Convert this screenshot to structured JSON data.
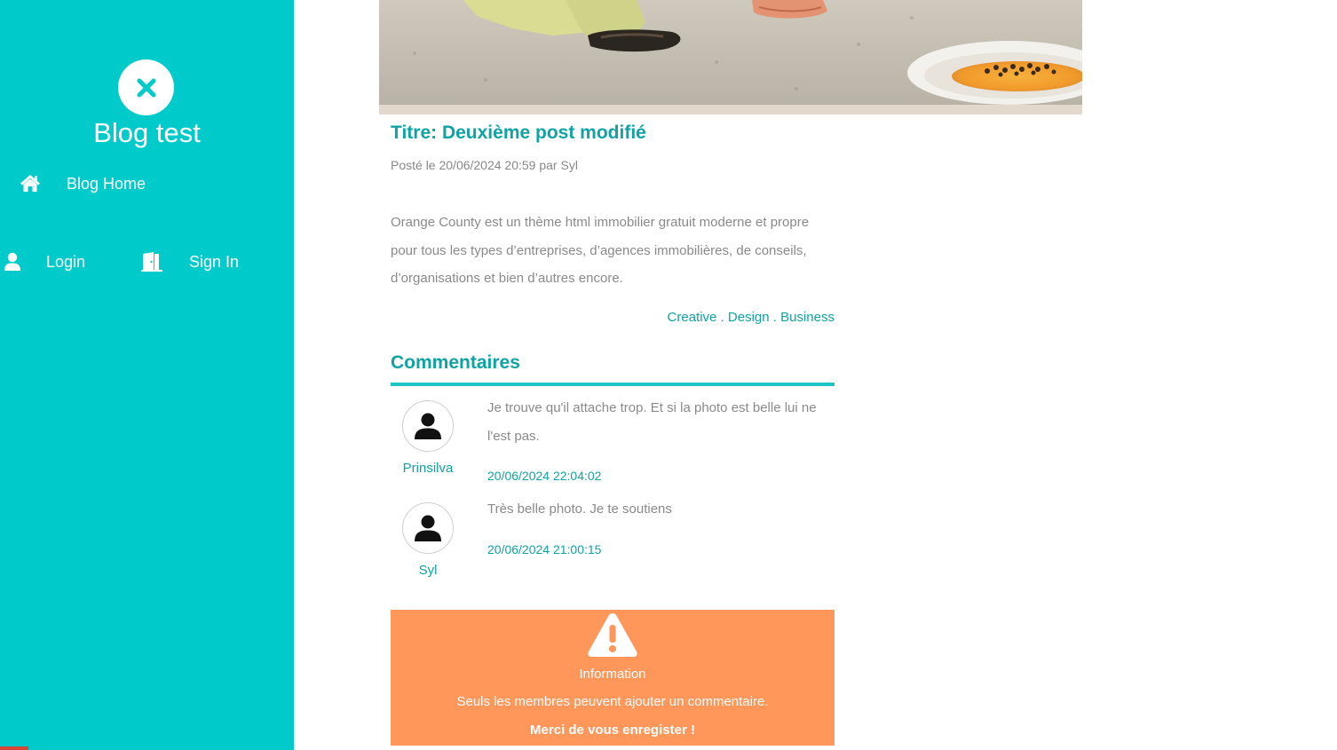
{
  "sidebar": {
    "close_icon": "close-icon",
    "brand": "Blog test",
    "nav": {
      "home_icon": "home-icon",
      "home_label": "Blog Home",
      "login_icon": "user-icon",
      "login_label": "Login",
      "signin_icon": "door-icon",
      "signin_label": "Sign In"
    }
  },
  "post": {
    "title": "Titre: Deuxième post modifié",
    "meta": "Posté le 20/06/2024 20:59 par Syl",
    "body": "Orange County est un thème html immobilier gratuit moderne et propre pour tous les types d’entreprises, d’agences immobilières, de conseils, d’organisations et bien d’autres encore.",
    "tags": [
      "Creative",
      "Design",
      "Business"
    ],
    "tag_separator": " . "
  },
  "comments": {
    "title": "Commentaires",
    "items": [
      {
        "author": "Prinsilva",
        "text": "Je trouve qu'il attache trop. Et si la photo est belle lui ne l'est pas.",
        "date": "20/06/2024 22:04:02"
      },
      {
        "author": "Syl",
        "text": "Très belle photo. Je te soutiens",
        "date": "20/06/2024 21:00:15"
      }
    ]
  },
  "alert": {
    "icon": "warning-icon",
    "title": "Information",
    "message": "Seuls les membres peuvent ajouter un commentaire.",
    "cta": "Merci de vous enregister !"
  },
  "colors": {
    "sidebar": "#00cbca",
    "accent": "#10a3a3",
    "rule": "#1ec3c3",
    "alert": "#ff965a",
    "muted_text": "#8a8a8a"
  }
}
